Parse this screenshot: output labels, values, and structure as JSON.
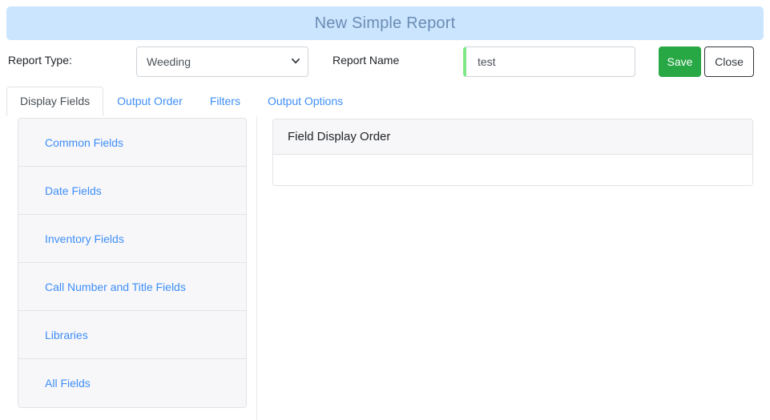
{
  "banner": {
    "title": "New Simple Report",
    "background_color": "#cce5ff",
    "text_color": "#6a8cb3"
  },
  "form": {
    "report_type_label": "Report Type:",
    "report_type_value": "Weeding",
    "report_type_options": [
      "Weeding"
    ],
    "select_chevron_icon": "chevron-down-icon",
    "report_name_label": "Report Name",
    "report_name_value": "test",
    "report_name_placeholder": "",
    "valid_accent_color": "#7ee787",
    "save_label": "Save",
    "save_color": "#28a745",
    "close_label": "Close"
  },
  "tabs": [
    {
      "label": "Display Fields",
      "active": true
    },
    {
      "label": "Output Order",
      "active": false
    },
    {
      "label": "Filters",
      "active": false
    },
    {
      "label": "Output Options",
      "active": false
    }
  ],
  "field_groups": [
    {
      "label": "Common Fields"
    },
    {
      "label": "Date Fields"
    },
    {
      "label": "Inventory Fields"
    },
    {
      "label": "Call Number and Title Fields"
    },
    {
      "label": "Libraries"
    },
    {
      "label": "All Fields"
    }
  ],
  "field_display_order": {
    "header": "Field Display Order",
    "items": []
  },
  "colors": {
    "link": "#3e8ef7",
    "border": "#e3e3e6",
    "panel_bg": "#f7f7f9"
  }
}
